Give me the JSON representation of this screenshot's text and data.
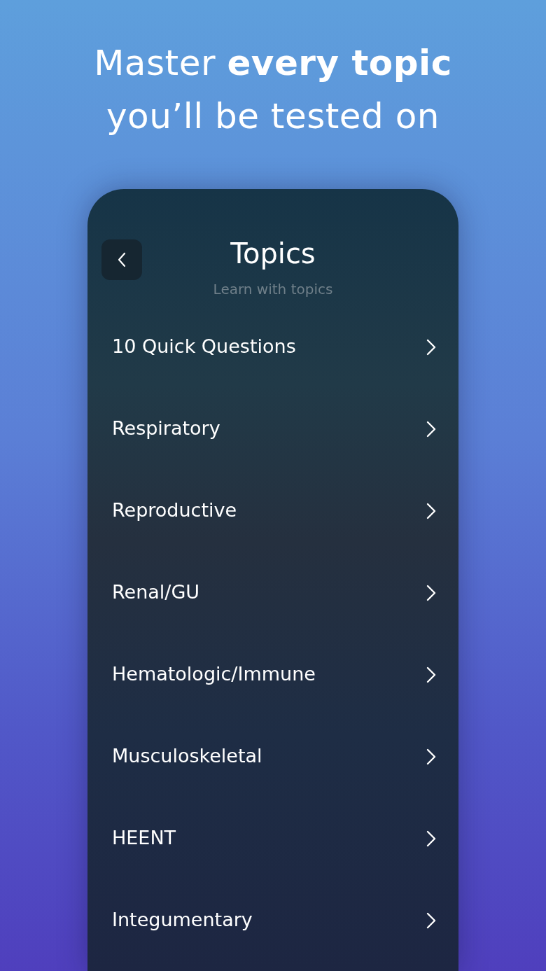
{
  "headline": [
    "Master **every topic**",
    "you’ll be tested on"
  ],
  "screen": {
    "title": "Topics",
    "subtitle": "Learn with topics",
    "topics": [
      {
        "label": "10 Quick Questions"
      },
      {
        "label": "Respiratory"
      },
      {
        "label": "Reproductive"
      },
      {
        "label": "Renal/GU"
      },
      {
        "label": "Hematologic/Immune"
      },
      {
        "label": "Musculoskeletal"
      },
      {
        "label": "HEENT"
      },
      {
        "label": "Integumentary"
      }
    ]
  }
}
